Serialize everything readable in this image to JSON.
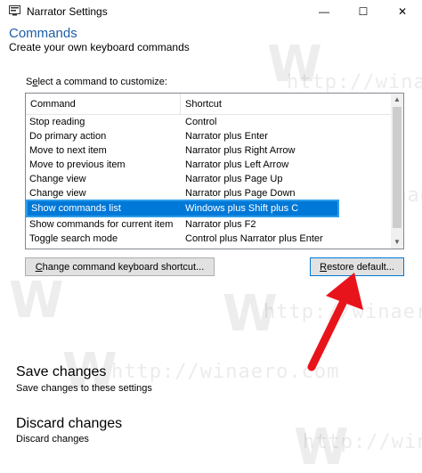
{
  "window": {
    "title": "Narrator Settings",
    "minimize_glyph": "—",
    "maximize_glyph": "☐",
    "close_glyph": "✕"
  },
  "header": {
    "title": "Commands",
    "subtitle": "Create your own keyboard commands"
  },
  "list": {
    "caption_pre": "S",
    "caption_accel": "e",
    "caption_post": "lect a command to customize:",
    "columns": [
      "Command",
      "Shortcut"
    ],
    "rows": [
      {
        "command": "Stop reading",
        "shortcut": "Control"
      },
      {
        "command": "Do primary action",
        "shortcut": "Narrator plus Enter"
      },
      {
        "command": "Move to next item",
        "shortcut": "Narrator plus Right Arrow"
      },
      {
        "command": "Move to previous item",
        "shortcut": "Narrator plus Left Arrow"
      },
      {
        "command": "Change view",
        "shortcut": "Narrator plus Page Up"
      },
      {
        "command": "Change view",
        "shortcut": "Narrator plus Page Down"
      },
      {
        "command": "Show commands list",
        "shortcut": "Windows plus Shift plus C"
      },
      {
        "command": "Show commands for current item",
        "shortcut": "Narrator plus F2"
      },
      {
        "command": "Toggle search mode",
        "shortcut": "Control plus Narrator plus Enter"
      }
    ],
    "selected_index": 6
  },
  "buttons": {
    "change_shortcut_accel": "C",
    "change_shortcut_rest": "hange command keyboard shortcut...",
    "restore_accel": "R",
    "restore_rest": "estore default..."
  },
  "actions": {
    "save_title": "Save changes",
    "save_desc": "Save changes to these settings",
    "discard_title": "Discard changes",
    "discard_desc": "Discard changes"
  },
  "watermark": {
    "letter": "W",
    "url": "http://winaero.com"
  },
  "colors": {
    "accent": "#1d5fa8",
    "selection": "#0078d7",
    "annotation_arrow": "#e8141c"
  },
  "icons": {
    "app": "narrator-app-icon",
    "scroll_up": "scroll-up-arrow-icon",
    "scroll_down": "scroll-down-arrow-icon",
    "annotation": "red-arrow-icon"
  }
}
